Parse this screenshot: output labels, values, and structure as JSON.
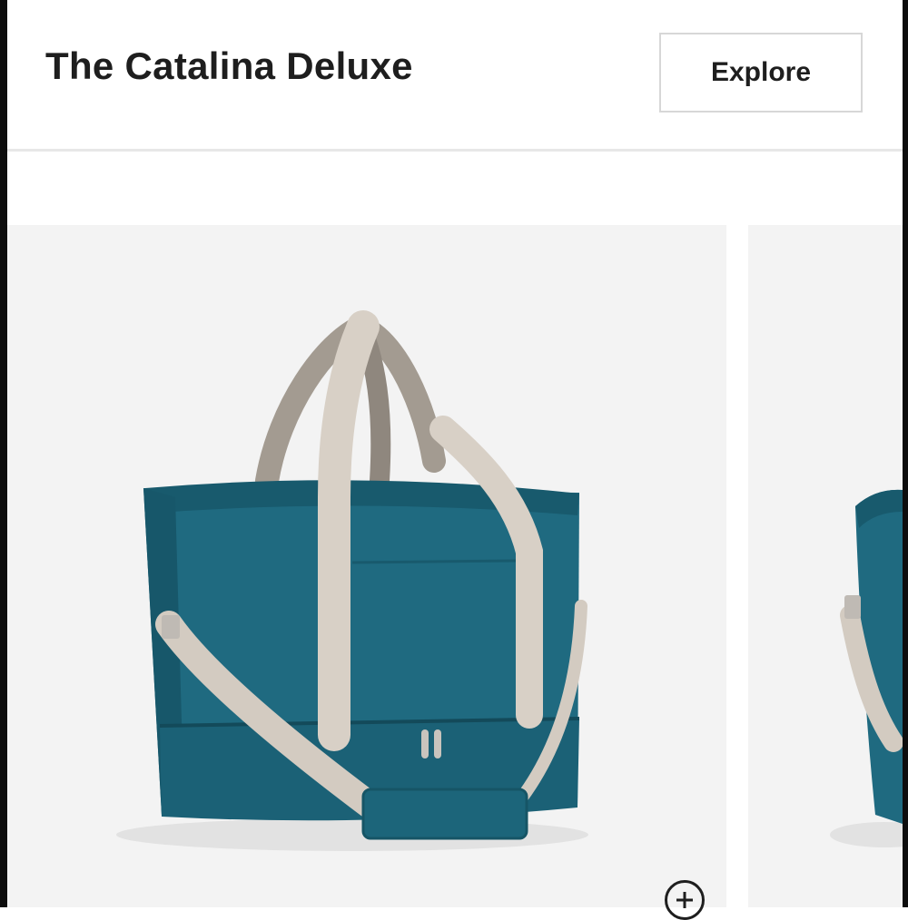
{
  "header": {
    "title": "The Catalina Deluxe",
    "explore_label": "Explore"
  },
  "gallery": {
    "images": [
      {
        "icon": "teal-weekender-bag-image"
      },
      {
        "icon": "teal-weekender-bag-image-partial"
      }
    ],
    "zoom_icon": "zoom-in-icon"
  },
  "colors": {
    "bag_teal": "#1f6a80",
    "strap_beige": "#d8d0c6",
    "card_background": "#f3f3f3",
    "text": "#1e1e1e"
  }
}
